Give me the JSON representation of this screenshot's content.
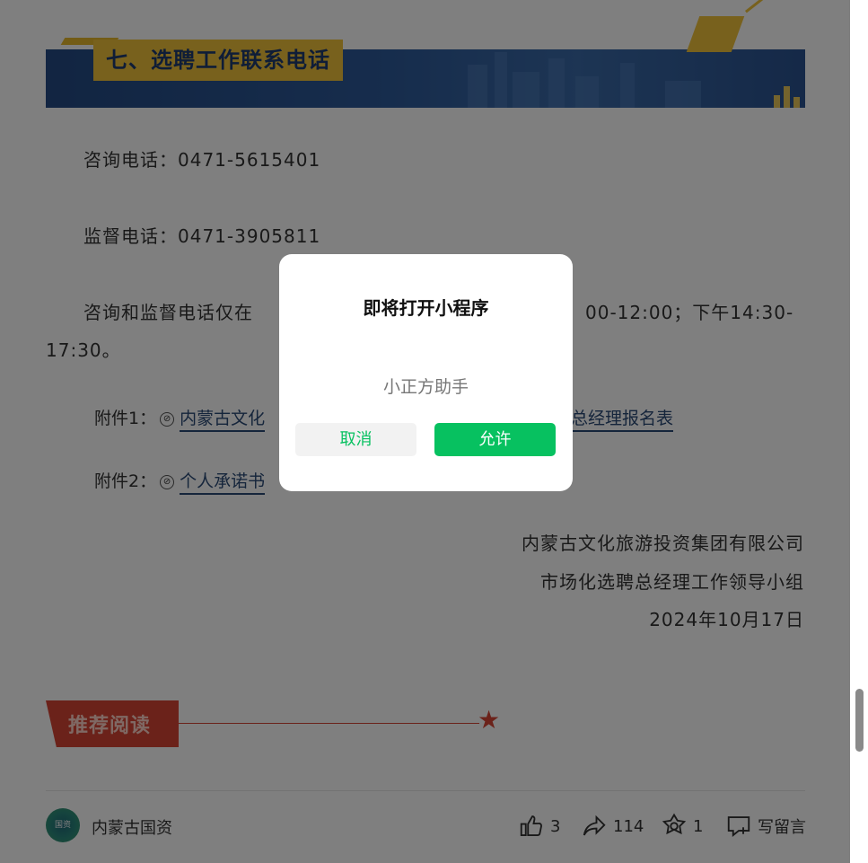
{
  "section": {
    "title": "七、选聘工作联系电话"
  },
  "contacts": {
    "consult": "咨询电话：0471-5615401",
    "supervise": "监督电话：0471-3905811",
    "hours_left": "咨询和监督电话仅在",
    "hours_right": "00-12:00；下午14:30-",
    "hours_line2": "17:30。"
  },
  "attachments": [
    {
      "label": "附件1：",
      "link_left": "内蒙古文化",
      "link_right": "总经理报名表"
    },
    {
      "label": "附件2：",
      "link_left": "个人承诺书"
    }
  ],
  "signature": {
    "org": "内蒙古文化旅游投资集团有限公司",
    "group": "市场化选聘总经理工作领导小组",
    "date": "2024年10月17日"
  },
  "recommend": {
    "label": "推荐阅读"
  },
  "footer": {
    "account": "内蒙古国资",
    "logo_text": "国资",
    "likes": "3",
    "shares": "114",
    "wows": "1",
    "comment_label": "写留言"
  },
  "dialog": {
    "title": "即将打开小程序",
    "app_name": "小正方助手",
    "cancel_label": "取消",
    "allow_label": "允许"
  },
  "colors": {
    "wechat_green": "#07c160",
    "banner_blue": "#244a84",
    "banner_gold": "#f0c23b",
    "recommend_red": "#d64534"
  },
  "icons": [
    "like-icon",
    "share-icon",
    "wow-icon",
    "comment-icon",
    "link-icon",
    "star-icon"
  ]
}
